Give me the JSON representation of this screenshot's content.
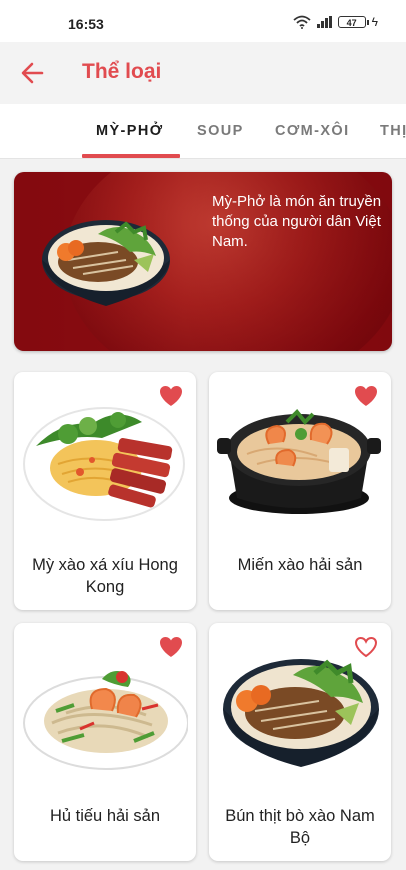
{
  "status_bar": {
    "time": "16:53",
    "battery": "47"
  },
  "app_bar": {
    "title": "Thể loại"
  },
  "tabs": [
    {
      "label": "MỲ-PHỞ",
      "active": true
    },
    {
      "label": "SOUP",
      "active": false
    },
    {
      "label": "CƠM-XÔI",
      "active": false
    },
    {
      "label": "THỊ",
      "active": false
    }
  ],
  "banner": {
    "text": "Mỳ-Phở là món ăn truyền thống của người dân Việt Nam."
  },
  "dishes": [
    {
      "name": "Mỳ xào xá xíu Hong Kong",
      "favorite": true
    },
    {
      "name": "Miến xào hải sản",
      "favorite": true
    },
    {
      "name": "Hủ tiếu hải sản",
      "favorite": true
    },
    {
      "name": "Bún thịt bò xào Nam Bộ",
      "favorite": false
    }
  ],
  "colors": {
    "accent": "#e14b4f",
    "banner": "#8b0d12"
  }
}
